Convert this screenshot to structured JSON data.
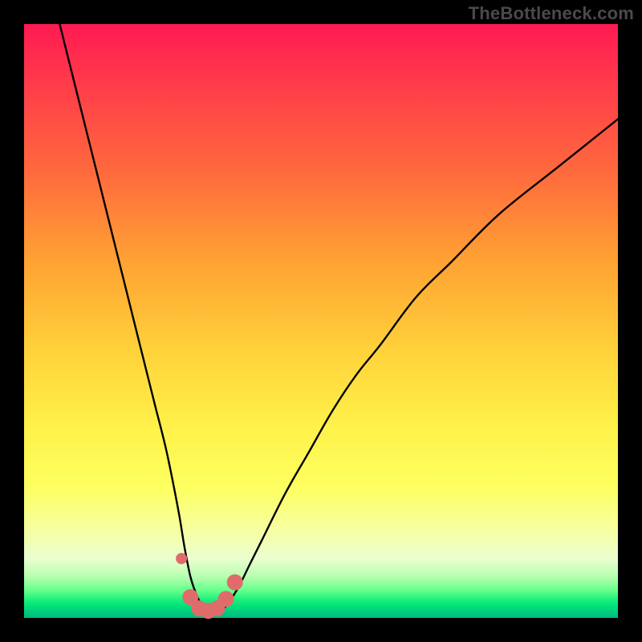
{
  "watermark": "TheBottleneck.com",
  "colors": {
    "frame": "#000000",
    "curve": "#000000",
    "marker": "#e06b6b",
    "gradient_top": "#ff1a53",
    "gradient_bottom": "#00b980"
  },
  "chart_data": {
    "type": "line",
    "title": "",
    "xlabel": "",
    "ylabel": "",
    "xlim": [
      0,
      100
    ],
    "ylim": [
      0,
      100
    ],
    "grid": false,
    "legend": false,
    "annotations": [
      "TheBottleneck.com"
    ],
    "series": [
      {
        "name": "bottleneck-curve",
        "x": [
          6,
          8,
          10,
          12,
          14,
          16,
          18,
          20,
          22,
          24,
          26,
          27,
          28,
          29,
          30,
          31,
          32,
          33,
          34,
          36,
          38,
          40,
          44,
          48,
          52,
          56,
          60,
          66,
          72,
          80,
          90,
          100
        ],
        "y": [
          100,
          92,
          84,
          76,
          68,
          60,
          52,
          44,
          36,
          28,
          18,
          12,
          7,
          4,
          2,
          1.2,
          1,
          1.2,
          2,
          5,
          9,
          13,
          21,
          28,
          35,
          41,
          46,
          54,
          60,
          68,
          76,
          84
        ]
      }
    ],
    "markers": {
      "name": "optimal-range-markers",
      "color": "#e06b6b",
      "points": [
        {
          "x": 26.5,
          "y": 10
        },
        {
          "x": 28,
          "y": 3.5
        },
        {
          "x": 29.5,
          "y": 1.6
        },
        {
          "x": 31,
          "y": 1.2
        },
        {
          "x": 32.5,
          "y": 1.6
        },
        {
          "x": 34,
          "y": 3.2
        },
        {
          "x": 35.5,
          "y": 6
        }
      ]
    }
  }
}
